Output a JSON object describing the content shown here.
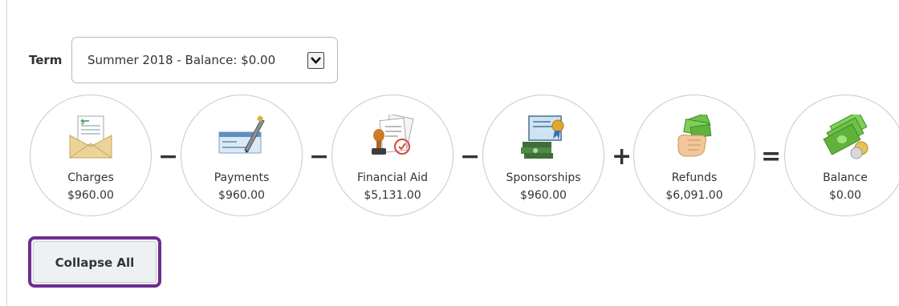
{
  "term": {
    "label": "Term",
    "selected": "Summer 2018 - Balance: $0.00"
  },
  "summary": [
    {
      "label": "Charges",
      "amount": "$960.00",
      "icon": "envelope-invoice-icon"
    },
    {
      "label": "Payments",
      "amount": "$960.00",
      "icon": "check-pen-icon"
    },
    {
      "label": "Financial Aid",
      "amount": "$5,131.00",
      "icon": "document-stamp-icon"
    },
    {
      "label": "Sponsorships",
      "amount": "$960.00",
      "icon": "certificate-money-icon"
    },
    {
      "label": "Refunds",
      "amount": "$6,091.00",
      "icon": "hand-cash-icon"
    },
    {
      "label": "Balance",
      "amount": "$0.00",
      "icon": "money-stack-icon"
    }
  ],
  "operators": [
    "−",
    "−",
    "−",
    "+",
    "="
  ],
  "actions": {
    "collapse_all": "Collapse All"
  },
  "colors": {
    "focus_outline": "#6e2e8e",
    "money_green": "#5fb33a"
  }
}
